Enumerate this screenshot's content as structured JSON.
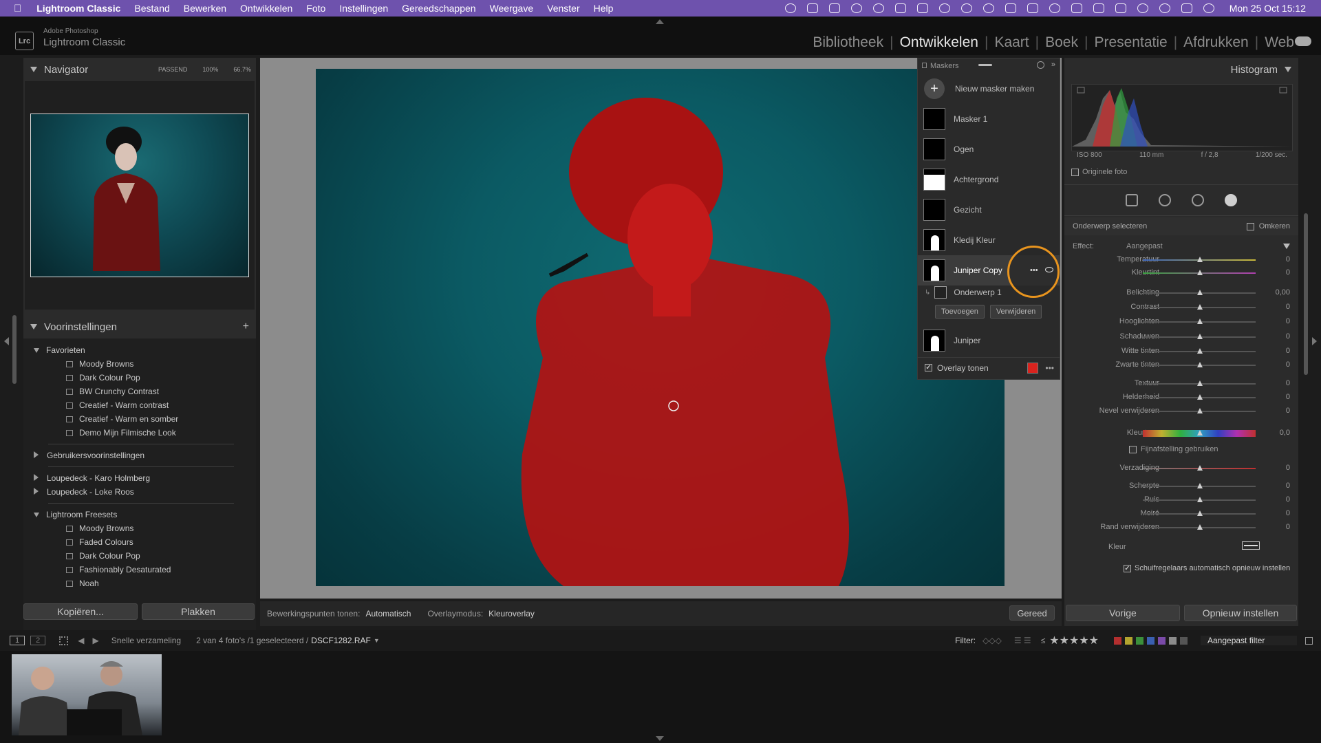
{
  "menubar": {
    "app_name": "Lightroom Classic",
    "items": [
      "Bestand",
      "Bewerken",
      "Ontwikkelen",
      "Foto",
      "Instellingen",
      "Gereedschappen",
      "Weergave",
      "Venster",
      "Help"
    ],
    "clock": "Mon 25 Oct  15:12"
  },
  "identity": {
    "small": "Adobe Photoshop",
    "big": "Lightroom Classic",
    "logo": "Lrc"
  },
  "modules": [
    "Bibliotheek",
    "Ontwikkelen",
    "Kaart",
    "Boek",
    "Presentatie",
    "Afdrukken",
    "Web"
  ],
  "active_module": "Ontwikkelen",
  "navigator": {
    "title": "Navigator",
    "opts": [
      "PASSEND",
      "100%",
      "66.7%"
    ]
  },
  "presets": {
    "title": "Voorinstellingen",
    "groups": [
      {
        "name": "Favorieten",
        "expanded": true,
        "items": [
          "Moody Browns",
          "Dark Colour Pop",
          "BW Crunchy Contrast",
          "Creatief - Warm contrast",
          "Creatief - Warm en somber",
          "Demo Mijn Filmische Look"
        ]
      },
      {
        "name": "Gebruikersvoorinstellingen",
        "expanded": false
      },
      {
        "name": "Loupedeck - Karo Holmberg",
        "expanded": false
      },
      {
        "name": "Loupedeck - Loke Roos",
        "expanded": false
      },
      {
        "name": "Lightroom Freesets",
        "expanded": true,
        "items": [
          "Moody Browns",
          "Faded Colours",
          "Dark Colour Pop",
          "Fashionably Desaturated",
          "Noah"
        ]
      }
    ]
  },
  "left_buttons": {
    "copy": "Kopiëren...",
    "paste": "Plakken"
  },
  "masks": {
    "title": "Maskers",
    "new_mask": "Nieuw masker maken",
    "items": [
      "Masker 1",
      "Ogen",
      "Achtergrond",
      "Gezicht",
      "Kledij Kleur",
      "Juniper Copy"
    ],
    "sub_item": "Onderwerp 1",
    "add": "Toevoegen",
    "remove": "Verwijderen",
    "last_item": "Juniper",
    "overlay_label": "Overlay tonen",
    "overlay_color": "#d9231e",
    "selected": "Juniper Copy"
  },
  "toolbar": {
    "edit_points_label": "Bewerkingspunten tonen:",
    "edit_points_value": "Automatisch",
    "overlay_mode_label": "Overlaymodus:",
    "overlay_mode_value": "Kleuroverlay",
    "done": "Gereed"
  },
  "histogram": {
    "title": "Histogram",
    "iso": "ISO 800",
    "focal": "110 mm",
    "aperture": "f / 2,8",
    "shutter": "1/200 sec.",
    "original": "Originele foto"
  },
  "mask_header": {
    "name": "Onderwerp selecteren",
    "invert": "Omkeren"
  },
  "effect": {
    "label": "Effect:",
    "value": "Aangepast"
  },
  "sliders": [
    {
      "label": "Temperatuur",
      "value": "0"
    },
    {
      "label": "Kleurtint",
      "value": "0"
    },
    {
      "label": "Belichting",
      "value": "0,00"
    },
    {
      "label": "Contrast",
      "value": "0"
    },
    {
      "label": "Hooglichten",
      "value": "0"
    },
    {
      "label": "Schaduwen",
      "value": "0"
    },
    {
      "label": "Witte tinten",
      "value": "0"
    },
    {
      "label": "Zwarte tinten",
      "value": "0"
    },
    {
      "label": "Textuur",
      "value": "0"
    },
    {
      "label": "Helderheid",
      "value": "0"
    },
    {
      "label": "Nevel verwijderen",
      "value": "0"
    },
    {
      "label": "Kleurtoon",
      "value": "0,0"
    },
    {
      "label": "Verzadiging",
      "value": "0"
    },
    {
      "label": "Scherpte",
      "value": "0"
    },
    {
      "label": "Ruis",
      "value": "0"
    },
    {
      "label": "Moiré",
      "value": "0"
    },
    {
      "label": "Rand verwijderen",
      "value": "0"
    }
  ],
  "fine_tune": "Fijnafstelling gebruiken",
  "color_label": "Kleur",
  "auto_reset": "Schuifregelaars automatisch opnieuw instellen",
  "right_buttons": {
    "prev": "Vorige",
    "reset": "Opnieuw instellen"
  },
  "filmbar": {
    "page1": "1",
    "page2": "2",
    "collection": "Snelle verzameling",
    "count": "2 van 4 foto's /1 geselecteerd /",
    "filename": "DSCF1282.RAF",
    "filter_label": "Filter:",
    "filter_value": "Aangepast filter",
    "color_labels": [
      "#b32f2f",
      "#b3a42f",
      "#3b8f3b",
      "#3a5fb0",
      "#7a4aa8",
      "#8c8c8c",
      "#555555"
    ]
  }
}
